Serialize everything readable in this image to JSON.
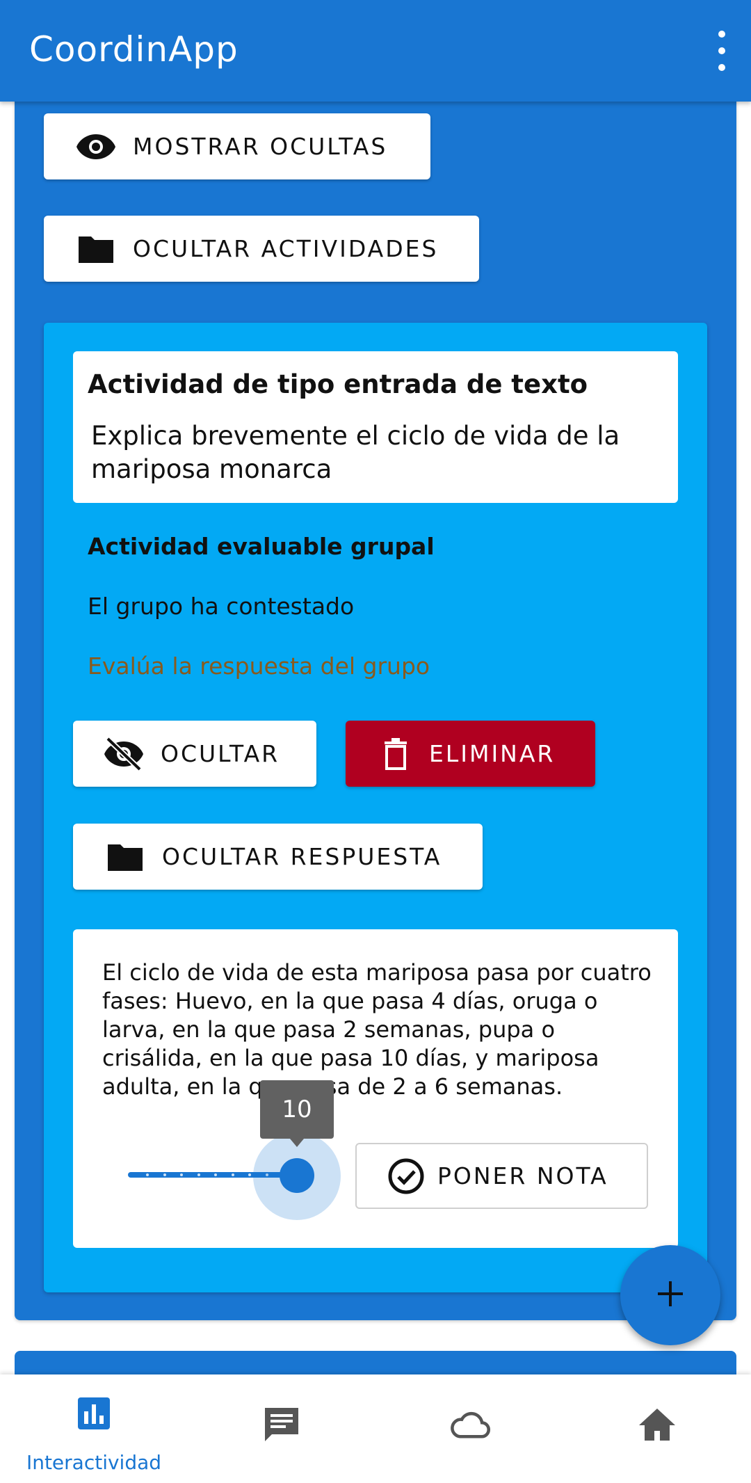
{
  "app": {
    "title": "CoordinApp"
  },
  "top_buttons": {
    "show_hidden": "MOSTRAR OCULTAS",
    "hide_activities": "OCULTAR ACTIVIDADES"
  },
  "activity": {
    "type_title": "Actividad de tipo entrada de texto",
    "question": "Explica brevemente el ciclo de vida de la mariposa monarca",
    "evaluable_label": "Actividad evaluable grupal",
    "status": "El grupo ha contestado",
    "evaluate_prompt": "Evalúa la respuesta del grupo",
    "hide_button": "OCULTAR",
    "delete_button": "ELIMINAR",
    "hide_answer_button": "OCULTAR RESPUESTA",
    "answer_text": "El ciclo de vida de esta mariposa pasa por cuatro fases: Huevo, en la que pasa 4 días, oruga o larva, en la que pasa 2 semanas, pupa o crisálida, en la que pasa 10 días, y mariposa adulta, en la que pasa de 2 a 6 semanas.",
    "grade_slider": {
      "value": "10",
      "min": 0,
      "max": 10
    },
    "grade_button": "PONER NOTA"
  },
  "fab": {
    "icon": "plus-icon"
  },
  "bottom_nav": {
    "items": [
      {
        "label": "Interactividad",
        "icon": "bar-chart-icon",
        "active": true
      },
      {
        "label": "",
        "icon": "chat-icon",
        "active": false
      },
      {
        "label": "",
        "icon": "cloud-icon",
        "active": false
      },
      {
        "label": "",
        "icon": "home-icon",
        "active": false
      }
    ]
  },
  "colors": {
    "primary": "#1976d2",
    "inner_card": "#03a9f4",
    "danger": "#b00020",
    "eval_text": "#8a5a1c",
    "tooltip": "#616161"
  }
}
